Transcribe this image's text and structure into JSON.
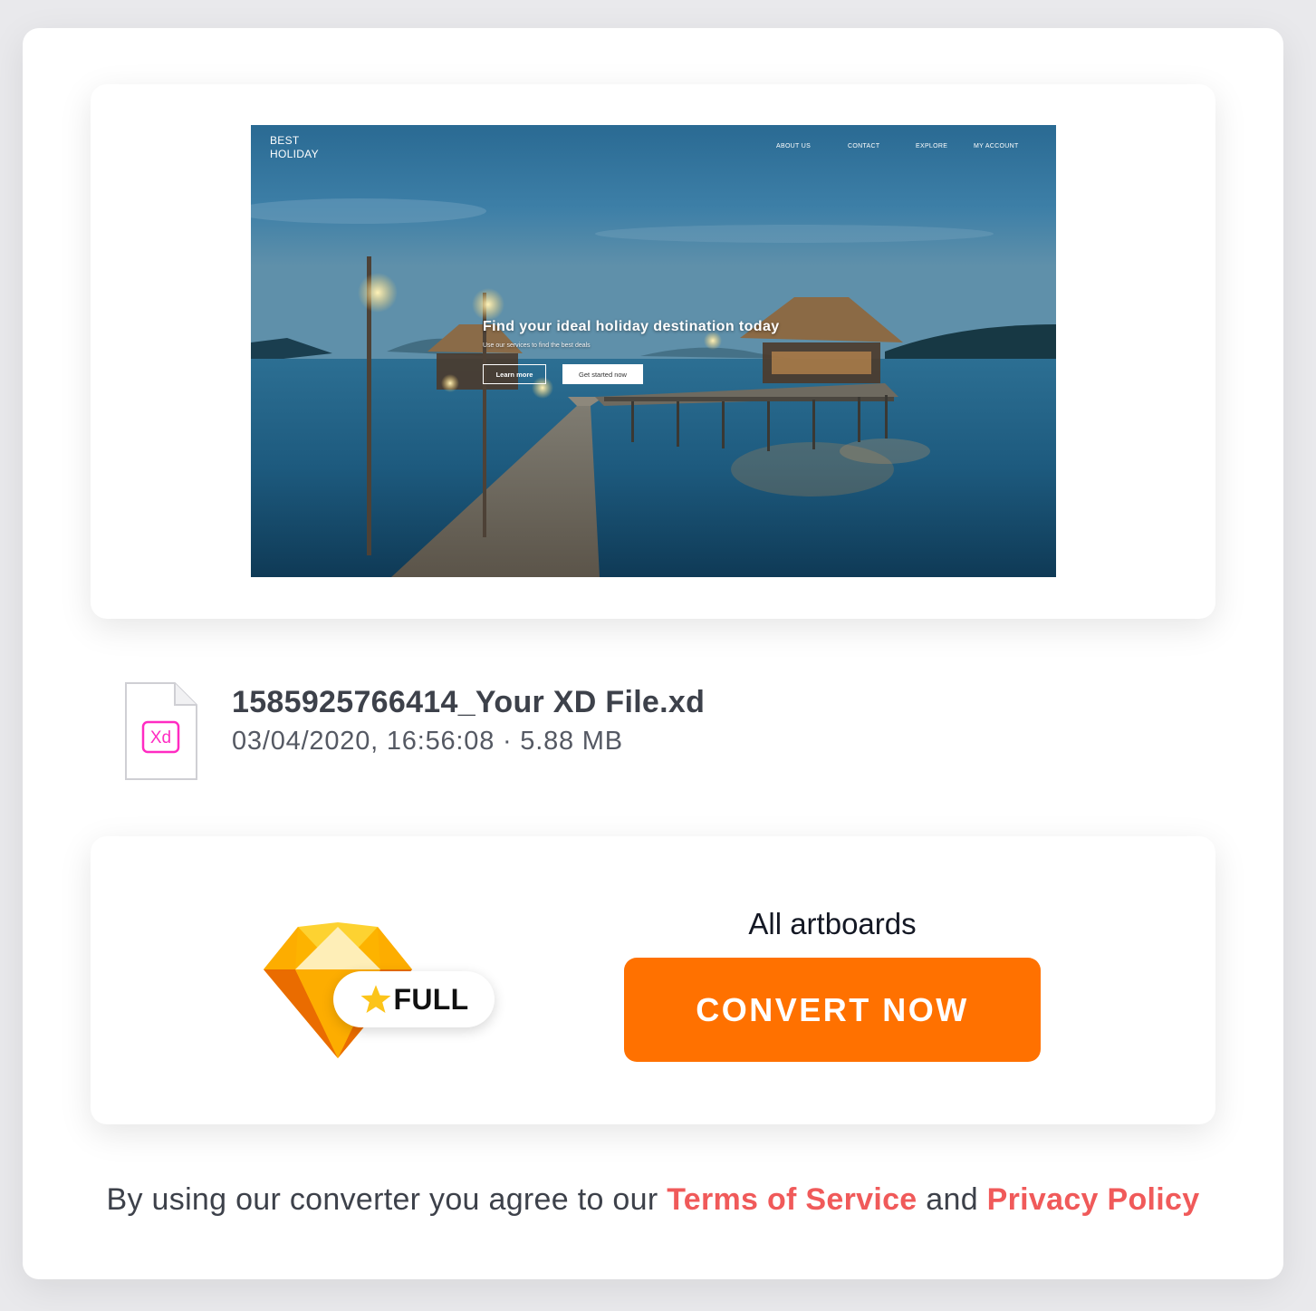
{
  "preview": {
    "logo_line1": "BEST",
    "logo_line2": "HOLIDAY",
    "nav": [
      "ABOUT US",
      "CONTACT",
      "EXPLORE",
      "MY ACCOUNT"
    ],
    "hero_title": "Find your ideal holiday destination today",
    "hero_subtitle": "Use our services to find the best deals",
    "btn_learn_more": "Learn more",
    "btn_get_started": "Get started now"
  },
  "file": {
    "icon_label": "Xd",
    "name": "1585925766414_Your XD File.xd",
    "meta": "03/04/2020, 16:56:08 · 5.88 MB",
    "icon": "xd-file-icon"
  },
  "convert": {
    "badge_label": "FULL",
    "scope_label": "All artboards",
    "button_label": "CONVERT NOW",
    "icons": [
      "sketch-gem-icon",
      "star-icon"
    ]
  },
  "legal": {
    "prefix": "By using our converter you agree to our",
    "terms_label": "Terms of Service",
    "conjunction": "and",
    "privacy_label": "Privacy Policy"
  },
  "colors": {
    "accent_orange": "#ff7100",
    "link_red": "#f05a5a",
    "xd_pink": "#ff2bc2"
  }
}
